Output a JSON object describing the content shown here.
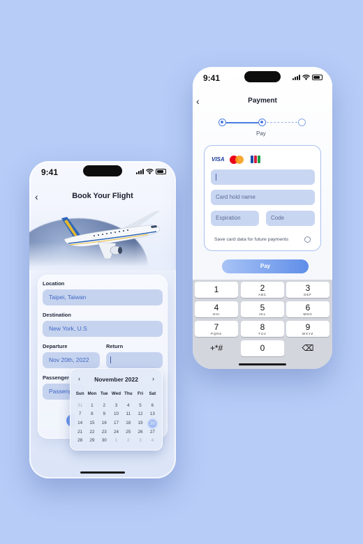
{
  "colors": {
    "background": "#b7ccf7",
    "accent": "#4b7de0",
    "input_fill": "#c6d3ef",
    "input_text": "#3f67c4"
  },
  "booking_screen": {
    "status_time": "9:41",
    "title": "Book Your Flight",
    "icons": {
      "back": "chevron-left-icon",
      "hero": "airplane-image"
    },
    "location": {
      "label": "Location",
      "value": "Taipei, Taiwan"
    },
    "destination": {
      "label": "Destination",
      "value": "New York, U.S"
    },
    "departure": {
      "label": "Departure",
      "value": "Nov 20th, 2022"
    },
    "return": {
      "label": "Return",
      "value": ""
    },
    "passenger": {
      "label": "Passenger",
      "value": "Passeng"
    },
    "calendar": {
      "month": "November 2022",
      "weekdays": [
        "Sun",
        "Mon",
        "Tue",
        "Wed",
        "Thu",
        "Fri",
        "Sat"
      ],
      "weeks": [
        [
          "31",
          "1",
          "2",
          "3",
          "4",
          "5",
          "6"
        ],
        [
          "7",
          "8",
          "9",
          "10",
          "11",
          "12",
          "13"
        ],
        [
          "14",
          "15",
          "16",
          "17",
          "18",
          "19",
          "20"
        ],
        [
          "21",
          "22",
          "23",
          "24",
          "25",
          "26",
          "27"
        ],
        [
          "28",
          "29",
          "30",
          "1",
          "2",
          "3",
          "4"
        ]
      ],
      "selected": "20"
    }
  },
  "payment_screen": {
    "status_time": "9:41",
    "title": "Payment",
    "step_label": "Pay",
    "steps_total": 3,
    "current_step": 2,
    "card_brands": [
      "VISA",
      "Mastercard",
      "JCB"
    ],
    "card_number": {
      "placeholder": ""
    },
    "card_holder": {
      "placeholder": "Card hold name"
    },
    "expiration": {
      "placeholder": "Expiration"
    },
    "code": {
      "placeholder": "Code"
    },
    "save_card_label": "Save card data for future payments",
    "pay_button": "Pay",
    "keypad": [
      {
        "num": "1",
        "letters": ""
      },
      {
        "num": "2",
        "letters": "ABC"
      },
      {
        "num": "3",
        "letters": "DEF"
      },
      {
        "num": "4",
        "letters": "GHI"
      },
      {
        "num": "5",
        "letters": "JKL"
      },
      {
        "num": "6",
        "letters": "MNO"
      },
      {
        "num": "7",
        "letters": "PQRS"
      },
      {
        "num": "8",
        "letters": "TUV"
      },
      {
        "num": "9",
        "letters": "WXYZ"
      },
      {
        "num": "+*#",
        "letters": ""
      },
      {
        "num": "0",
        "letters": ""
      },
      {
        "num": "⌫",
        "letters": ""
      }
    ]
  }
}
